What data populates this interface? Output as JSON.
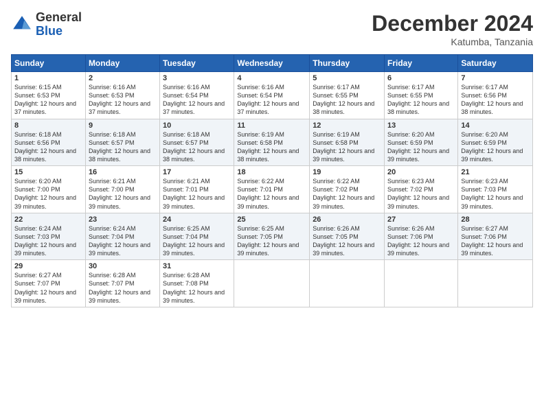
{
  "logo": {
    "general": "General",
    "blue": "Blue"
  },
  "title": "December 2024",
  "location": "Katumba, Tanzania",
  "days": [
    "Sunday",
    "Monday",
    "Tuesday",
    "Wednesday",
    "Thursday",
    "Friday",
    "Saturday"
  ],
  "weeks": [
    [
      {
        "day": "1",
        "sunrise": "6:15 AM",
        "sunset": "6:53 PM",
        "daylight": "12 hours and 37 minutes."
      },
      {
        "day": "2",
        "sunrise": "6:16 AM",
        "sunset": "6:53 PM",
        "daylight": "12 hours and 37 minutes."
      },
      {
        "day": "3",
        "sunrise": "6:16 AM",
        "sunset": "6:54 PM",
        "daylight": "12 hours and 37 minutes."
      },
      {
        "day": "4",
        "sunrise": "6:16 AM",
        "sunset": "6:54 PM",
        "daylight": "12 hours and 37 minutes."
      },
      {
        "day": "5",
        "sunrise": "6:17 AM",
        "sunset": "6:55 PM",
        "daylight": "12 hours and 38 minutes."
      },
      {
        "day": "6",
        "sunrise": "6:17 AM",
        "sunset": "6:55 PM",
        "daylight": "12 hours and 38 minutes."
      },
      {
        "day": "7",
        "sunrise": "6:17 AM",
        "sunset": "6:56 PM",
        "daylight": "12 hours and 38 minutes."
      }
    ],
    [
      {
        "day": "8",
        "sunrise": "6:18 AM",
        "sunset": "6:56 PM",
        "daylight": "12 hours and 38 minutes."
      },
      {
        "day": "9",
        "sunrise": "6:18 AM",
        "sunset": "6:57 PM",
        "daylight": "12 hours and 38 minutes."
      },
      {
        "day": "10",
        "sunrise": "6:18 AM",
        "sunset": "6:57 PM",
        "daylight": "12 hours and 38 minutes."
      },
      {
        "day": "11",
        "sunrise": "6:19 AM",
        "sunset": "6:58 PM",
        "daylight": "12 hours and 38 minutes."
      },
      {
        "day": "12",
        "sunrise": "6:19 AM",
        "sunset": "6:58 PM",
        "daylight": "12 hours and 39 minutes."
      },
      {
        "day": "13",
        "sunrise": "6:20 AM",
        "sunset": "6:59 PM",
        "daylight": "12 hours and 39 minutes."
      },
      {
        "day": "14",
        "sunrise": "6:20 AM",
        "sunset": "6:59 PM",
        "daylight": "12 hours and 39 minutes."
      }
    ],
    [
      {
        "day": "15",
        "sunrise": "6:20 AM",
        "sunset": "7:00 PM",
        "daylight": "12 hours and 39 minutes."
      },
      {
        "day": "16",
        "sunrise": "6:21 AM",
        "sunset": "7:00 PM",
        "daylight": "12 hours and 39 minutes."
      },
      {
        "day": "17",
        "sunrise": "6:21 AM",
        "sunset": "7:01 PM",
        "daylight": "12 hours and 39 minutes."
      },
      {
        "day": "18",
        "sunrise": "6:22 AM",
        "sunset": "7:01 PM",
        "daylight": "12 hours and 39 minutes."
      },
      {
        "day": "19",
        "sunrise": "6:22 AM",
        "sunset": "7:02 PM",
        "daylight": "12 hours and 39 minutes."
      },
      {
        "day": "20",
        "sunrise": "6:23 AM",
        "sunset": "7:02 PM",
        "daylight": "12 hours and 39 minutes."
      },
      {
        "day": "21",
        "sunrise": "6:23 AM",
        "sunset": "7:03 PM",
        "daylight": "12 hours and 39 minutes."
      }
    ],
    [
      {
        "day": "22",
        "sunrise": "6:24 AM",
        "sunset": "7:03 PM",
        "daylight": "12 hours and 39 minutes."
      },
      {
        "day": "23",
        "sunrise": "6:24 AM",
        "sunset": "7:04 PM",
        "daylight": "12 hours and 39 minutes."
      },
      {
        "day": "24",
        "sunrise": "6:25 AM",
        "sunset": "7:04 PM",
        "daylight": "12 hours and 39 minutes."
      },
      {
        "day": "25",
        "sunrise": "6:25 AM",
        "sunset": "7:05 PM",
        "daylight": "12 hours and 39 minutes."
      },
      {
        "day": "26",
        "sunrise": "6:26 AM",
        "sunset": "7:05 PM",
        "daylight": "12 hours and 39 minutes."
      },
      {
        "day": "27",
        "sunrise": "6:26 AM",
        "sunset": "7:06 PM",
        "daylight": "12 hours and 39 minutes."
      },
      {
        "day": "28",
        "sunrise": "6:27 AM",
        "sunset": "7:06 PM",
        "daylight": "12 hours and 39 minutes."
      }
    ],
    [
      {
        "day": "29",
        "sunrise": "6:27 AM",
        "sunset": "7:07 PM",
        "daylight": "12 hours and 39 minutes."
      },
      {
        "day": "30",
        "sunrise": "6:28 AM",
        "sunset": "7:07 PM",
        "daylight": "12 hours and 39 minutes."
      },
      {
        "day": "31",
        "sunrise": "6:28 AM",
        "sunset": "7:08 PM",
        "daylight": "12 hours and 39 minutes."
      },
      null,
      null,
      null,
      null
    ]
  ]
}
